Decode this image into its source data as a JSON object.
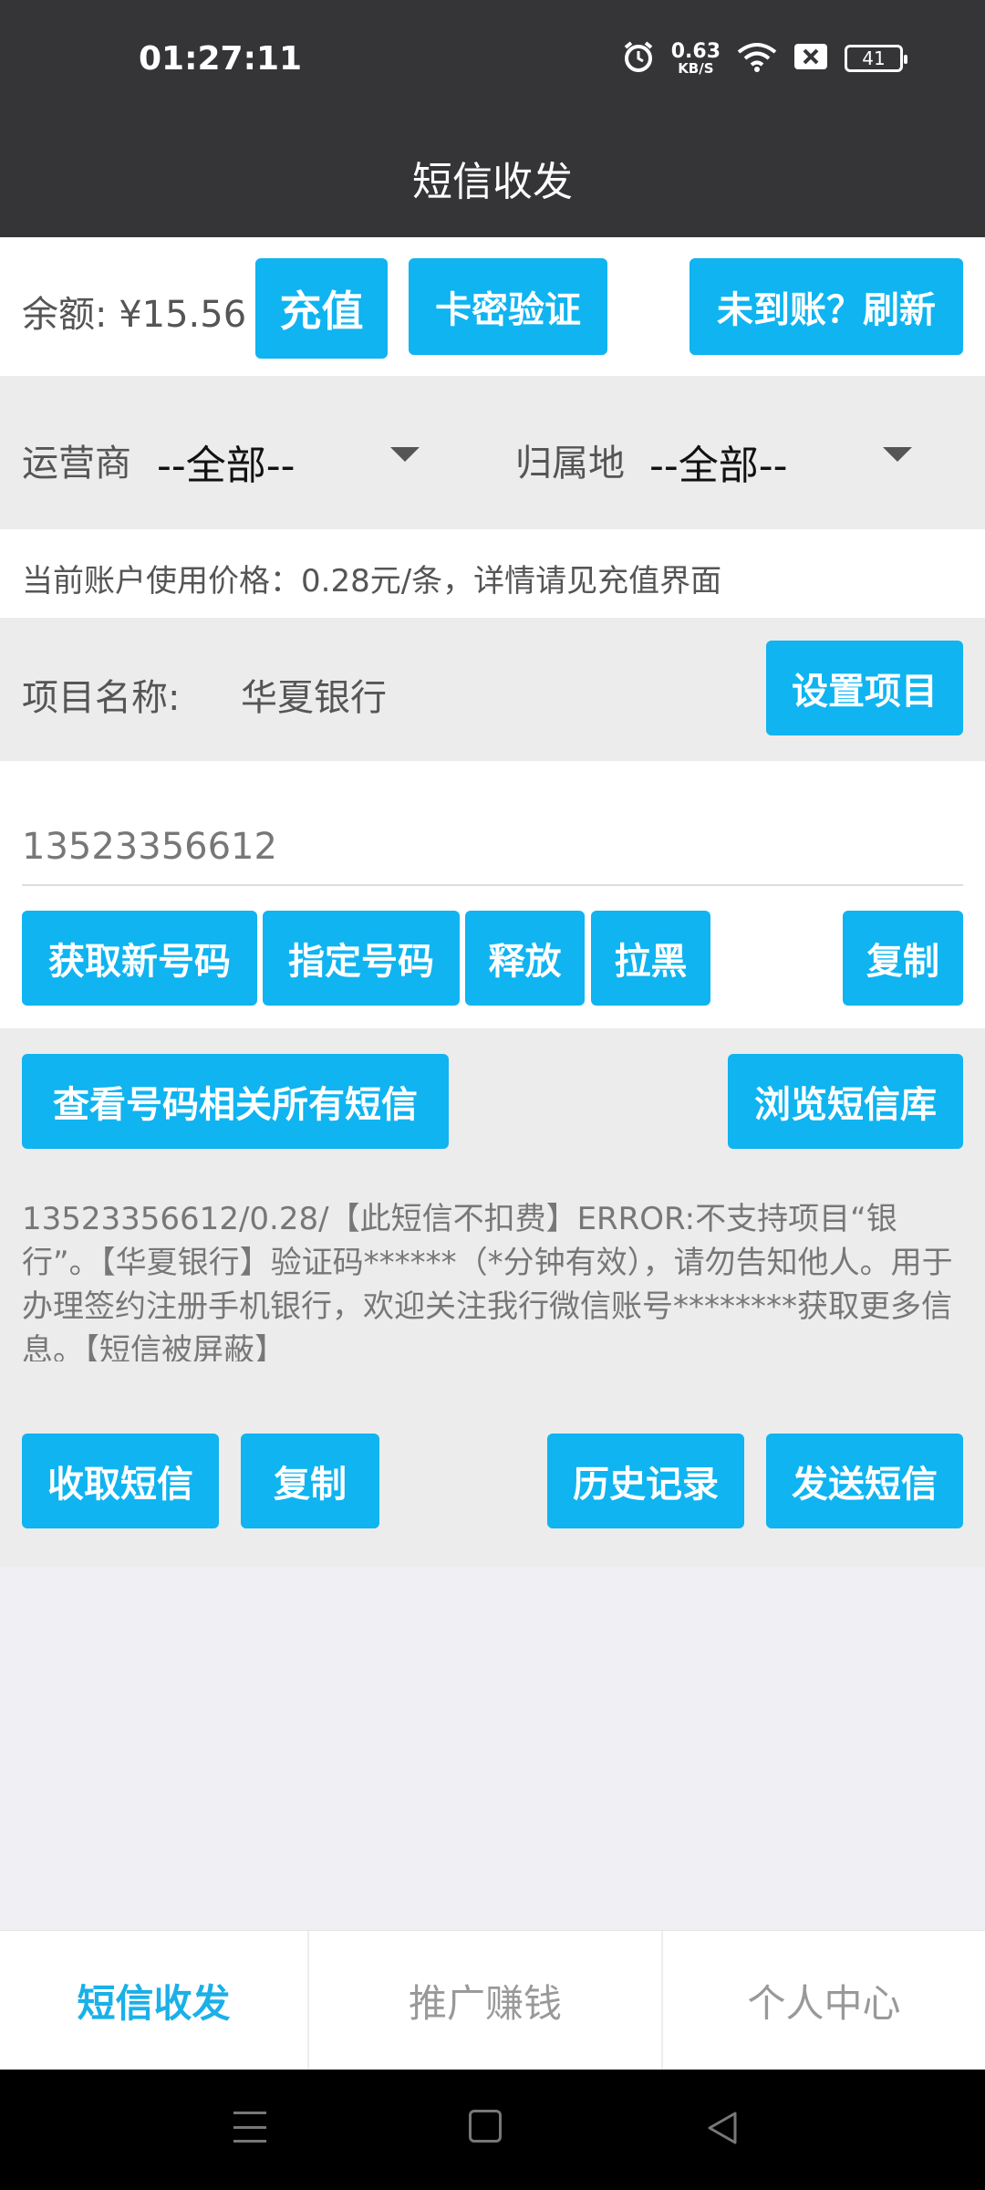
{
  "status_bar": {
    "time": "01:27:11",
    "net_speed_value": "0.63",
    "net_speed_unit": "KB/S",
    "battery_level": "41"
  },
  "header": {
    "title": "短信收发"
  },
  "balance": {
    "label": "余额: ¥15.56",
    "recharge_button": "充值",
    "card_verify_button": "卡密验证",
    "refresh_button": "未到账？刷新"
  },
  "filters": {
    "carrier_label": "运营商",
    "carrier_value": "--全部--",
    "region_label": "归属地",
    "region_value": "--全部--"
  },
  "price_notice": "当前账户使用价格：0.28元/条，详情请见充值界面",
  "project": {
    "label": "项目名称:",
    "value": "华夏银行",
    "set_button": "设置项目"
  },
  "phone": {
    "number": "13523356612",
    "get_new_button": "获取新号码",
    "specify_button": "指定号码",
    "release_button": "释放",
    "blacklist_button": "拉黑",
    "copy_button": "复制"
  },
  "sms": {
    "view_all_button": "查看号码相关所有短信",
    "browse_library_button": "浏览短信库",
    "content": "13523356612/0.28/【此短信不扣费】ERROR:不支持项目“银行”。【华夏银行】验证码******（*分钟有效），请勿告知他人。用于办理签约注册手机银行，欢迎关注我行微信账号********获取更多信息。【短信被屏蔽】",
    "receive_button": "收取短信",
    "copy_button": "复制",
    "history_button": "历史记录",
    "send_button": "发送短信"
  },
  "tabs": [
    {
      "label": "短信收发",
      "active": true
    },
    {
      "label": "推广赚钱",
      "active": false
    },
    {
      "label": "个人中心",
      "active": false
    }
  ],
  "colors": {
    "accent": "#0fb4f0",
    "header_bg": "#353538",
    "tab_active": "#1ab0e8"
  }
}
